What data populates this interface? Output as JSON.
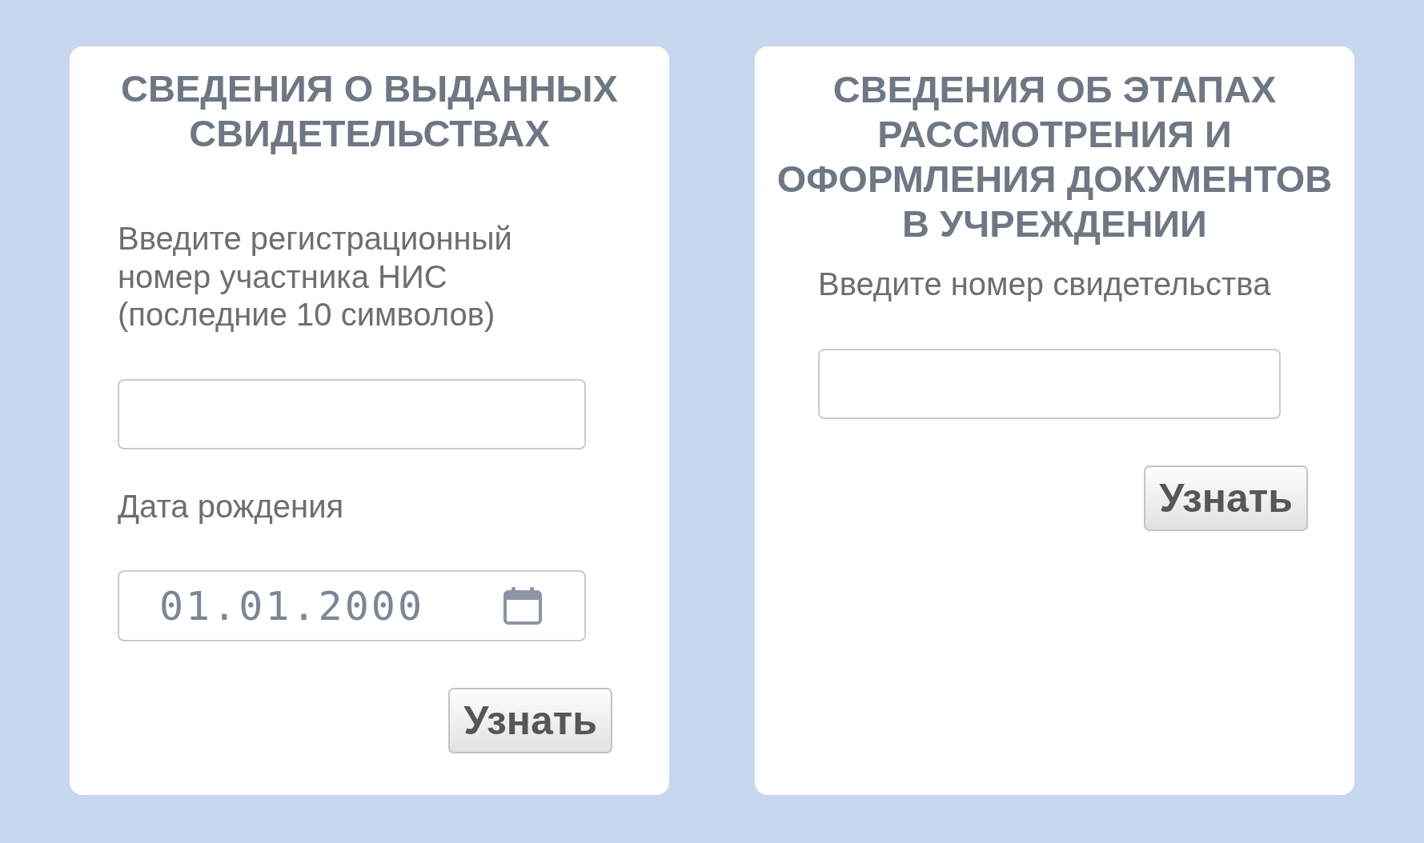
{
  "panels": [
    {
      "title": "СВЕДЕНИЯ О ВЫДАННЫХ СВИДЕТЕЛЬСТВАХ",
      "fields": [
        {
          "kind": "text",
          "label": "Введите регистрационный номер участника НИС (последние 10 символов)"
        },
        {
          "kind": "date",
          "label": "Дата рождения",
          "value": "01.01.2000"
        }
      ],
      "button": "Узнать"
    },
    {
      "title": "СВЕДЕНИЯ ОБ ЭТАПАХ РАССМОТРЕНИЯ И ОФОРМЛЕНИЯ ДОКУМЕНТОВ В УЧРЕЖДЕНИИ",
      "fields": [
        {
          "kind": "text",
          "label": "Введите номер свидетельства"
        }
      ],
      "button": "Узнать"
    }
  ]
}
